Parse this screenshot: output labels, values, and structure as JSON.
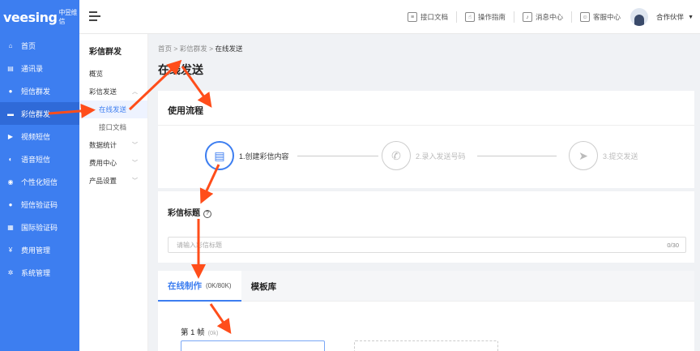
{
  "brand": {
    "name": "veesing",
    "sub": "中昱维信"
  },
  "sidebar": {
    "items": [
      {
        "label": "首页",
        "icon": "home-icon",
        "glyph": "⌂"
      },
      {
        "label": "通讯录",
        "icon": "contacts-icon",
        "glyph": "▤"
      },
      {
        "label": "短信群发",
        "icon": "sms-icon",
        "glyph": "●"
      },
      {
        "label": "彩信群发",
        "icon": "mms-icon",
        "glyph": "▬"
      },
      {
        "label": "视频短信",
        "icon": "video-icon",
        "glyph": "▶"
      },
      {
        "label": "语音短信",
        "icon": "voice-icon",
        "glyph": "◐"
      },
      {
        "label": "个性化短信",
        "icon": "user-icon",
        "glyph": "◉"
      },
      {
        "label": "短信验证码",
        "icon": "verify-icon",
        "glyph": "●"
      },
      {
        "label": "国际验证码",
        "icon": "global-icon",
        "glyph": "▦"
      },
      {
        "label": "费用管理",
        "icon": "fee-icon",
        "glyph": "¥"
      },
      {
        "label": "系统管理",
        "icon": "settings-icon",
        "glyph": "✲"
      }
    ],
    "active_index": 3
  },
  "topbar": {
    "links": [
      {
        "label": "接口文档",
        "icon": "doc-icon",
        "glyph": "≡"
      },
      {
        "label": "操作指南",
        "icon": "hand-icon",
        "glyph": "☝"
      },
      {
        "label": "消息中心",
        "icon": "bell-icon",
        "glyph": "♪"
      },
      {
        "label": "客服中心",
        "icon": "support-icon",
        "glyph": "☺"
      }
    ],
    "user": "合作伙伴"
  },
  "subnav": {
    "title": "彩信群发",
    "overview": "概览",
    "group_send": "彩信发送",
    "online_send": "在线发送",
    "api_doc": "接口文档",
    "stats": "数据统计",
    "fees": "费用中心",
    "product": "产品设置"
  },
  "breadcrumb": {
    "home": "首页",
    "section": "彩信群发",
    "current": "在线发送"
  },
  "page_title": "在线发送",
  "flow": {
    "title": "使用流程",
    "steps": [
      {
        "label": "1.创建彩信内容",
        "glyph": "▤"
      },
      {
        "label": "2.录入发送号码",
        "glyph": "✆"
      },
      {
        "label": "3.提交发送",
        "glyph": "➤"
      }
    ]
  },
  "mms_title": {
    "label": "彩信标题",
    "help": "?",
    "placeholder": "请输入彩信标题",
    "count": "0/30"
  },
  "tabs": {
    "online": "在线制作",
    "online_size": "(0K/80K)",
    "template": "模板库"
  },
  "frame": {
    "label": "第 1 帧",
    "size": "(0k)"
  },
  "colors": {
    "primary": "#3d7ef0",
    "annotation": "#ff4d1a"
  }
}
